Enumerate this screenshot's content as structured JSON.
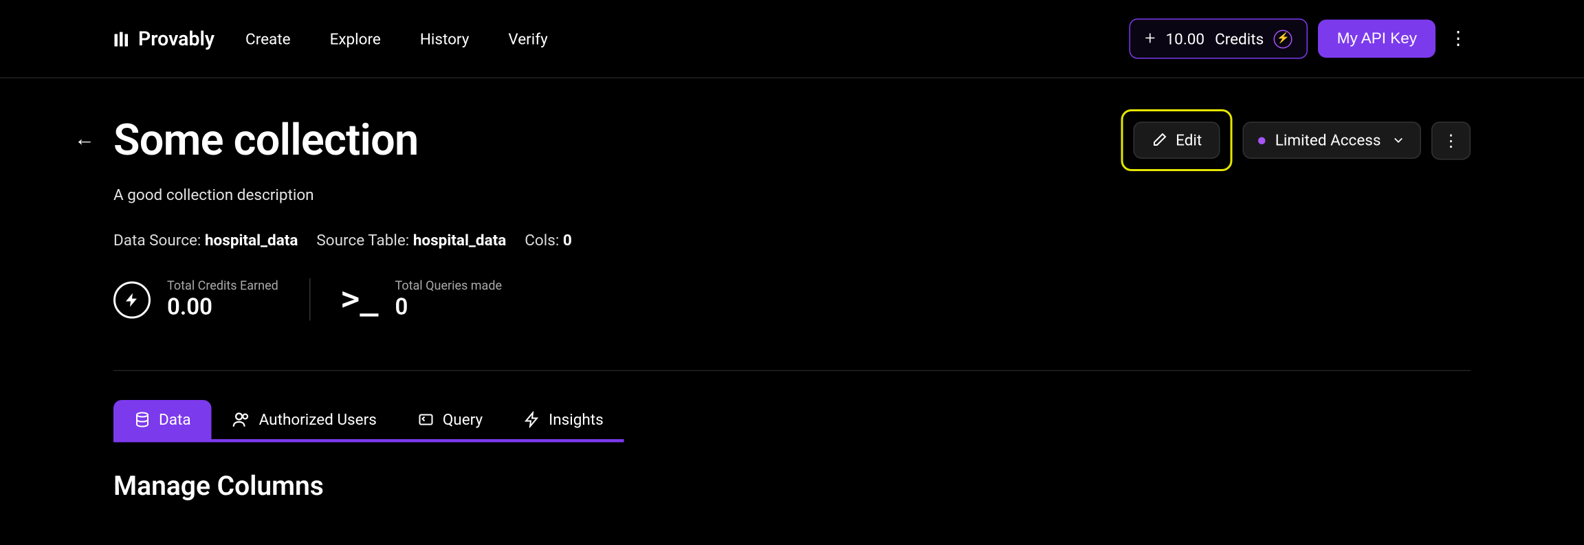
{
  "brand": "Provably",
  "nav": {
    "create": "Create",
    "explore": "Explore",
    "history": "History",
    "verify": "Verify"
  },
  "header": {
    "credits_amount": "10.00",
    "credits_label": "Credits",
    "api_key": "My API Key"
  },
  "page": {
    "title": "Some collection",
    "description": "A good collection description",
    "edit_label": "Edit",
    "access_label": "Limited Access"
  },
  "meta": {
    "datasource_label": "Data Source:",
    "datasource_value": "hospital_data",
    "sourcetable_label": "Source Table:",
    "sourcetable_value": "hospital_data",
    "cols_label": "Cols:",
    "cols_value": "0"
  },
  "stats": {
    "credits_label": "Total Credits Earned",
    "credits_value": "0.00",
    "queries_label": "Total Queries made",
    "queries_value": "0"
  },
  "tabs": {
    "data": "Data",
    "users": "Authorized Users",
    "query": "Query",
    "insights": "Insights"
  },
  "section": {
    "manage_columns": "Manage Columns"
  }
}
